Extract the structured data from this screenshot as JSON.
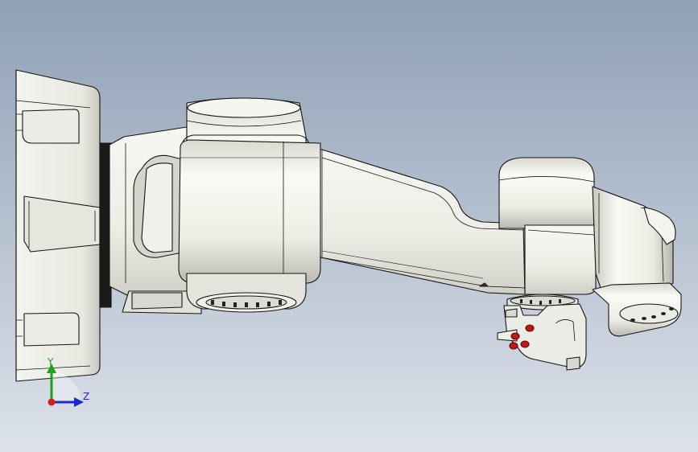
{
  "viewport": {
    "background_top": "#8fa0b6",
    "background_bottom": "#dde2ea",
    "model_fill": "#f0f0ea",
    "model_shadow": "#c4c4bc",
    "model_edge": "#141414",
    "highlight_red": "#c01818"
  },
  "triad": {
    "y_label": "Y",
    "z_label": "Z",
    "y_color": "#1ea01e",
    "z_color": "#1e28d2",
    "x_color": "#d21e1e"
  }
}
